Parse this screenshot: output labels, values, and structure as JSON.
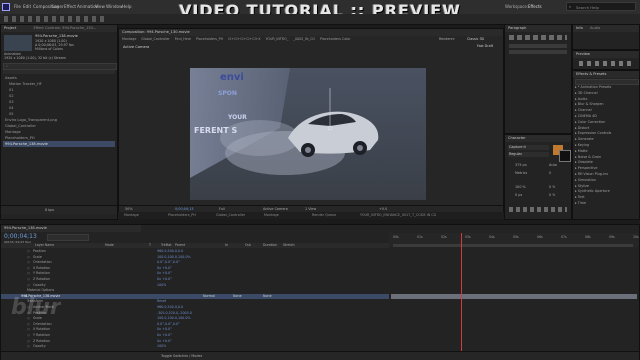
{
  "banner": "VIDEO TUTORIAL :: PREVIEW",
  "menu": [
    "File",
    "Edit",
    "Composition",
    "Layer",
    "Effect",
    "Animation",
    "View",
    "Window",
    "Help"
  ],
  "workspace": {
    "label": "Workspace:",
    "value": "Effects",
    "search_placeholder": "Search Help"
  },
  "project": {
    "tab": "Project",
    "effect_controls_tab": "Effect Controls: 994.Porsche_130...",
    "comp_name": "994.Porsche_138.movie",
    "comp_info1": "1920 x 1080 (1.00)",
    "comp_info2": "Δ 0;00;06;03, 29.97 fps",
    "comp_info3": "Millions of Colors",
    "comp_info4": "Animation",
    "comp_info5": "1920 x 1080 (1.00), 32 bit (c) Stream",
    "list": [
      "Assets",
      "Motion Tracker_HF",
      "01",
      "02",
      "03",
      "04",
      "05",
      "Enviro Logo_Transparent.png",
      "Global_Controller",
      "Montage",
      "Placeholders_PH",
      "994.Porsche_138.movie"
    ],
    "bpc": "8 bpc"
  },
  "viewer": {
    "tab": "Composition: 994.Porsche_130.movie",
    "breadcrumbs": [
      "Montage",
      "Global_Controller",
      "Find_Here",
      "Placeholders_PH",
      "CI+CI+CI+CI+CI+X",
      "YOUR_INTRO_",
      "_0002_IN_CG",
      "Placeholders Color"
    ],
    "camera": "Active Camera",
    "renderer": "Renderer:",
    "renderer_value": "Classic 3D",
    "fast_draft": "Fast Draft",
    "comp_text1": "envi",
    "comp_text2": "SPON",
    "comp_text3": "YOUR",
    "comp_text4": "FERENT S",
    "bottom": {
      "zoom": "50%",
      "time": "0;00;04;13",
      "res": "Full",
      "cam": "Active Camera",
      "view": "1 View",
      "offset": "+0.0"
    },
    "flowchart": [
      "Montage",
      "Placeholders_PH",
      "Global_Controller",
      "Montage",
      "Render Queue",
      "YOUR_INTRO_ENHANCE_0017_T_CODE IN CG"
    ]
  },
  "right": {
    "info_tab": "Info",
    "audio_tab": "Audio",
    "paragraph_tab": "Paragraph",
    "preview_tab": "Preview",
    "effects_tab": "Effects & Presets",
    "effects": [
      "* Animation Presets",
      "3D Channel",
      "Audio",
      "Blur & Sharpen",
      "Channel",
      "CINEMA 4D",
      "Color Correction",
      "Distort",
      "Expression Controls",
      "Generate",
      "Keying",
      "Matte",
      "Noise & Grain",
      "Obsolete",
      "Perspective",
      "RE:Vision Plug-ins",
      "Simulation",
      "Stylize",
      "Synthetic Aperture",
      "Text",
      "Time"
    ],
    "character_tab": "Character",
    "font": "Capture it",
    "style": "Regular",
    "size1": "375 px",
    "size2": "Auto",
    "metrics": "Metrics",
    "kern": "0",
    "leading": "100 %",
    "tracking": "0 %",
    "baseline": "0 px",
    "tsume": "0 %"
  },
  "timeline": {
    "tabs": [
      "994.Porsche_138.movie"
    ],
    "timecode": "0;00;04;13",
    "fps": "00133 (29.97 fps)",
    "headers": [
      "Layer Name",
      "Mode",
      "T",
      "TrkMat",
      "Parent",
      "In",
      "Out",
      "Duration",
      "Stretch"
    ],
    "ruler": [
      "00s",
      "01s",
      "02s",
      "03s",
      "04s",
      "05s",
      "06s",
      "07s",
      "08s",
      "09s",
      "10s"
    ],
    "rows": [
      {
        "name": "Position",
        "val": "960.0,540.0,0.0",
        "depth": 3
      },
      {
        "name": "Scale",
        "val": "100.0,100.0,100.0%",
        "depth": 3
      },
      {
        "name": "Orientation",
        "val": "0.0°,0.0°,0.0°",
        "depth": 3
      },
      {
        "name": "X Rotation",
        "val": "0x +0.0°",
        "depth": 3
      },
      {
        "name": "Y Rotation",
        "val": "0x +0.0°",
        "depth": 3
      },
      {
        "name": "Z Rotation",
        "val": "0x +0.0°",
        "depth": 3
      },
      {
        "name": "Opacity",
        "val": "100%",
        "depth": 3
      },
      {
        "name": "Material Options",
        "val": "",
        "depth": 2
      },
      {
        "name": "994.Porsche_138.movie",
        "val": "",
        "depth": 1,
        "layer": true,
        "num": "6"
      },
      {
        "name": "Transform",
        "val": "Reset",
        "depth": 2
      },
      {
        "name": "Anchor Point",
        "val": "960.0,540.0,0.0",
        "depth": 3
      },
      {
        "name": "Position",
        "val": "-305.0,520.0,-2005.0",
        "depth": 3
      },
      {
        "name": "Scale",
        "val": "100.0,100.0,100.0%",
        "depth": 3
      },
      {
        "name": "Orientation",
        "val": "0.0°,0.0°,0.0°",
        "depth": 3
      },
      {
        "name": "X Rotation",
        "val": "0x +0.0°",
        "depth": 3
      },
      {
        "name": "Y Rotation",
        "val": "0x +0.0°",
        "depth": 3
      },
      {
        "name": "Z Rotation",
        "val": "0x +0.0°",
        "depth": 3
      },
      {
        "name": "Opacity",
        "val": "100%",
        "depth": 3
      }
    ],
    "layer_mode": "Normal",
    "layer_trk": "None",
    "layer_parent": "None",
    "toggle": "Toggle Switches / Modes"
  },
  "watermark": "blur"
}
